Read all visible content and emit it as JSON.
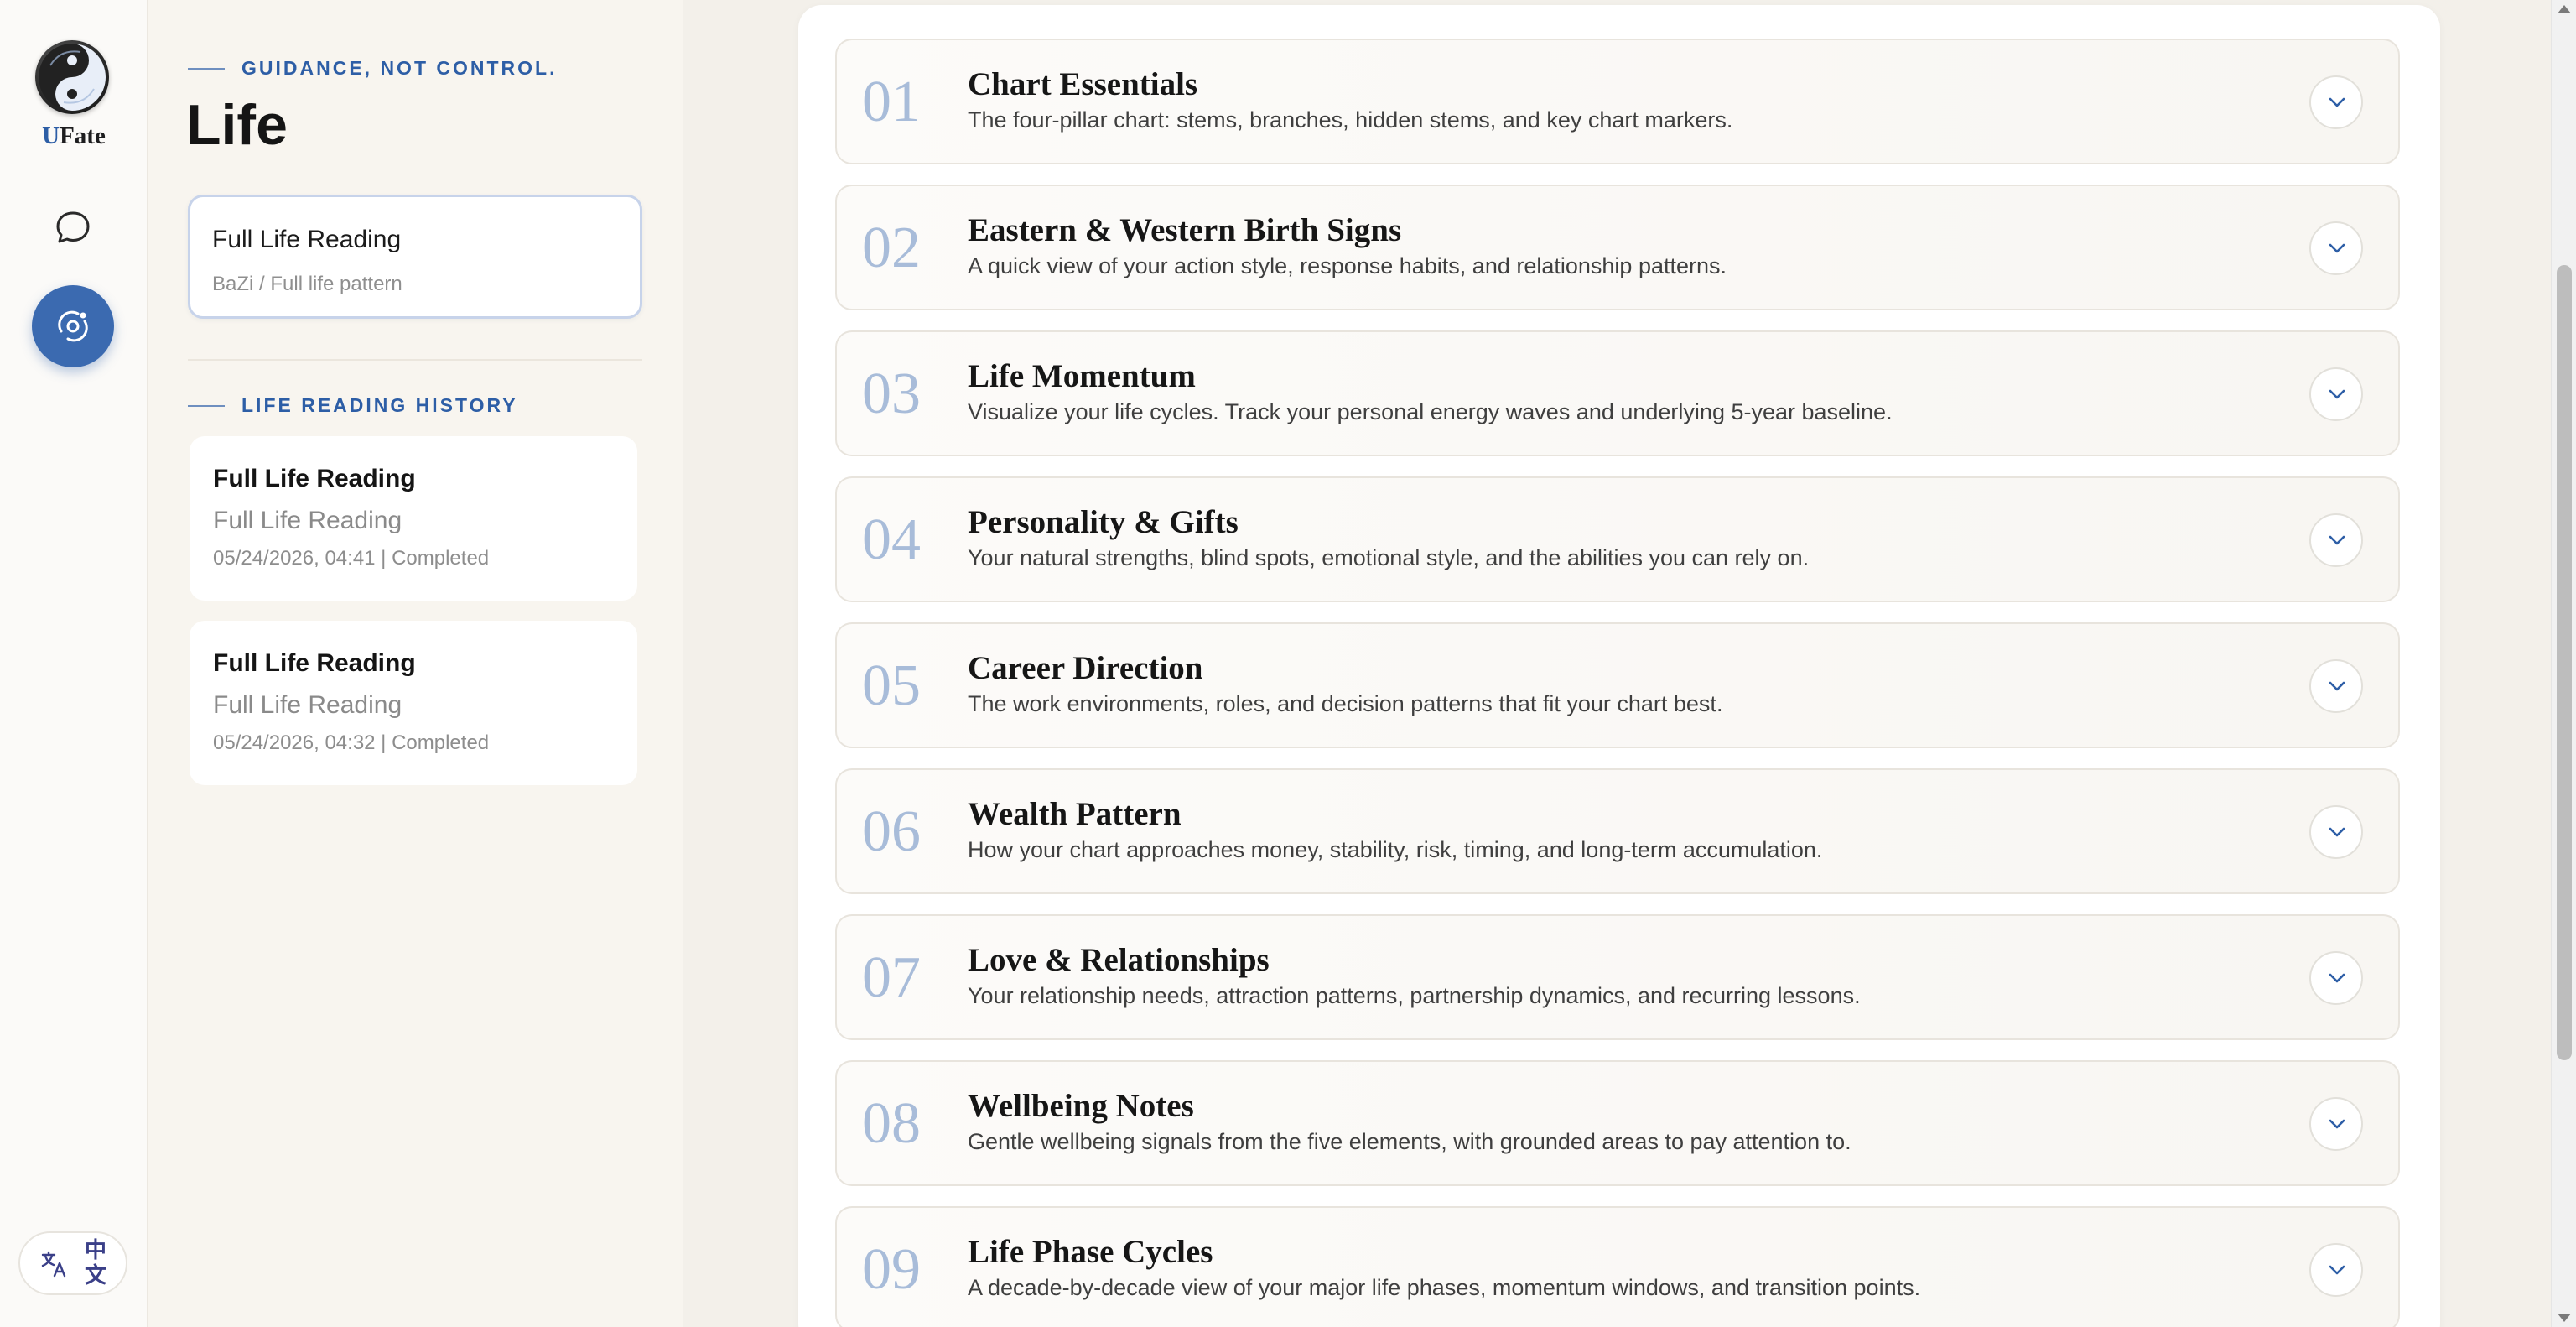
{
  "app": {
    "brand_prefix": "U",
    "brand_rest": "Fate"
  },
  "rail": {
    "icons": [
      "yin-yang-logo",
      "chat-bubble-icon",
      "orbit-icon",
      "translate-icon"
    ],
    "language_toggle": "中文",
    "accent_color": "#3b6ab0"
  },
  "sidebar": {
    "eyebrow": "GUIDANCE, NOT CONTROL.",
    "title": "Life",
    "current": {
      "title": "Full Life Reading",
      "subtitle": "BaZi / Full life pattern"
    },
    "history_heading": "LIFE READING HISTORY",
    "history": [
      {
        "title": "Full Life Reading",
        "subtitle": "Full Life Reading",
        "meta": "05/24/2026, 04:41 | Completed"
      },
      {
        "title": "Full Life Reading",
        "subtitle": "Full Life Reading",
        "meta": "05/24/2026, 04:32 | Completed"
      }
    ]
  },
  "sections": [
    {
      "num": "01",
      "title": "Chart Essentials",
      "desc": "The four-pillar chart: stems, branches, hidden stems, and key chart markers."
    },
    {
      "num": "02",
      "title": "Eastern & Western Birth Signs",
      "desc": "A quick view of your action style, response habits, and relationship patterns."
    },
    {
      "num": "03",
      "title": "Life Momentum",
      "desc": "Visualize your life cycles. Track your personal energy waves and underlying 5-year baseline."
    },
    {
      "num": "04",
      "title": "Personality & Gifts",
      "desc": "Your natural strengths, blind spots, emotional style, and the abilities you can rely on."
    },
    {
      "num": "05",
      "title": "Career Direction",
      "desc": "The work environments, roles, and decision patterns that fit your chart best."
    },
    {
      "num": "06",
      "title": "Wealth Pattern",
      "desc": "How your chart approaches money, stability, risk, timing, and long-term accumulation."
    },
    {
      "num": "07",
      "title": "Love & Relationships",
      "desc": "Your relationship needs, attraction patterns, partnership dynamics, and recurring lessons."
    },
    {
      "num": "08",
      "title": "Wellbeing Notes",
      "desc": "Gentle wellbeing signals from the five elements, with grounded areas to pay attention to."
    },
    {
      "num": "09",
      "title": "Life Phase Cycles",
      "desc": "A decade-by-decade view of your major life phases, momentum windows, and transition points."
    }
  ]
}
